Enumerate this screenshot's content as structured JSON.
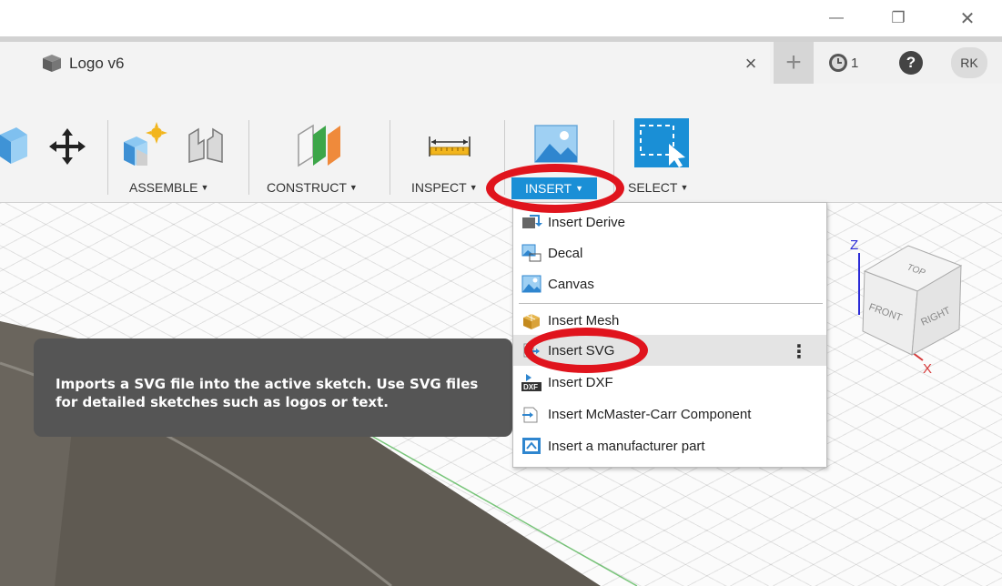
{
  "window": {
    "minimize_glyph": "—",
    "restore_glyph": "❐",
    "close_glyph": "✕"
  },
  "tab": {
    "title": "Logo v6",
    "close_glyph": "×",
    "new_tab_glyph": "+"
  },
  "status": {
    "jobs_count": "1",
    "help_glyph": "?",
    "user_initials": "RK"
  },
  "toolbar": {
    "groups": [
      {
        "label": "ASSEMBLE"
      },
      {
        "label": "CONSTRUCT"
      },
      {
        "label": "INSPECT"
      },
      {
        "label": "INSERT"
      },
      {
        "label": "SELECT"
      }
    ],
    "caret": "▼"
  },
  "insert_menu": {
    "items": [
      {
        "label": "Insert Derive",
        "icon": "derive-icon"
      },
      {
        "label": "Decal",
        "icon": "decal-icon"
      },
      {
        "label": "Canvas",
        "icon": "canvas-icon"
      },
      {
        "label": "Insert Mesh",
        "icon": "mesh-icon"
      },
      {
        "label": "Insert SVG",
        "icon": "svg-icon",
        "highlighted": true
      },
      {
        "label": "Insert DXF",
        "icon": "dxf-icon"
      },
      {
        "label": "Insert McMaster-Carr Component",
        "icon": "mcmaster-icon"
      },
      {
        "label": "Insert a manufacturer part",
        "icon": "manufacturer-part-icon"
      }
    ],
    "more_glyph": "⋮",
    "dxf_badge": "DXF"
  },
  "tooltip": {
    "text": "Imports a SVG file into the active sketch. Use SVG files for detailed sketches such as logos or text."
  },
  "viewcube": {
    "top": "TOP",
    "front": "FRONT",
    "right": "RIGHT",
    "axis_z": "Z",
    "axis_x": "X"
  },
  "colors": {
    "accent": "#1a8fd6",
    "highlight_oval": "#e0141d",
    "tooltip_bg": "#555555"
  }
}
